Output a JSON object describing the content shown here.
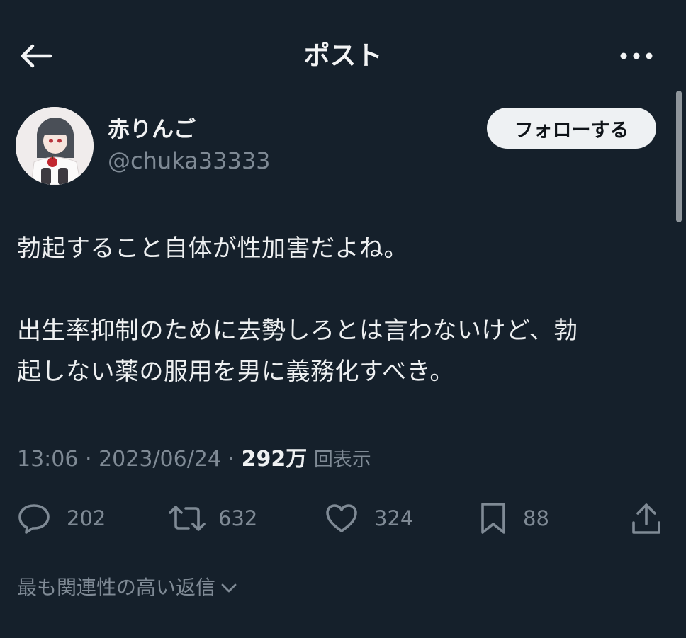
{
  "header": {
    "title": "ポスト",
    "back_icon": "arrow-left-icon",
    "more_icon": "ellipsis-icon"
  },
  "author": {
    "display_name": "赤りんご",
    "handle": "@chuka33333",
    "follow_label": "フォローする",
    "avatar_icon": "avatar-illustration"
  },
  "post": {
    "paragraph_1": "勃起すること自体が性加害だよね。",
    "paragraph_2_line_1": "出生率抑制のために去勢しろとは言わないけど、勃",
    "paragraph_2_line_2": "起しない薬の服用を男に義務化すべき。",
    "time": "13:06",
    "date": "2023/06/24",
    "views_count": "292万",
    "views_label": "回表示"
  },
  "actions": {
    "replies": "202",
    "reposts": "632",
    "likes": "324",
    "bookmarks": "88"
  },
  "replies_sort": {
    "label": "最も関連性の高い返信"
  },
  "colors": {
    "background": "#15202b",
    "text_primary": "#e7e9ea",
    "text_secondary": "#7f8a95",
    "follow_bg": "#eef1f3"
  }
}
